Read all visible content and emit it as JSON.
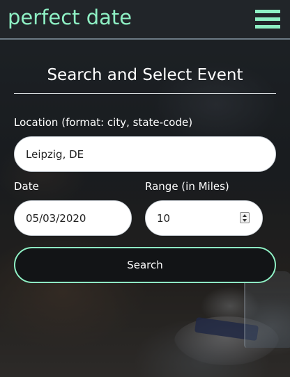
{
  "header": {
    "brand": "perfect date",
    "menu_icon": "hamburger-menu-icon",
    "accent_color": "#8ef0c4"
  },
  "form": {
    "title": "Search and Select Event",
    "location": {
      "label": "Location (format: city, state-code)",
      "value": "Leipzig, DE"
    },
    "date": {
      "label": "Date",
      "value": "05/03/2020"
    },
    "range": {
      "label": "Range (in Miles)",
      "value": "10"
    },
    "search_label": "Search"
  }
}
